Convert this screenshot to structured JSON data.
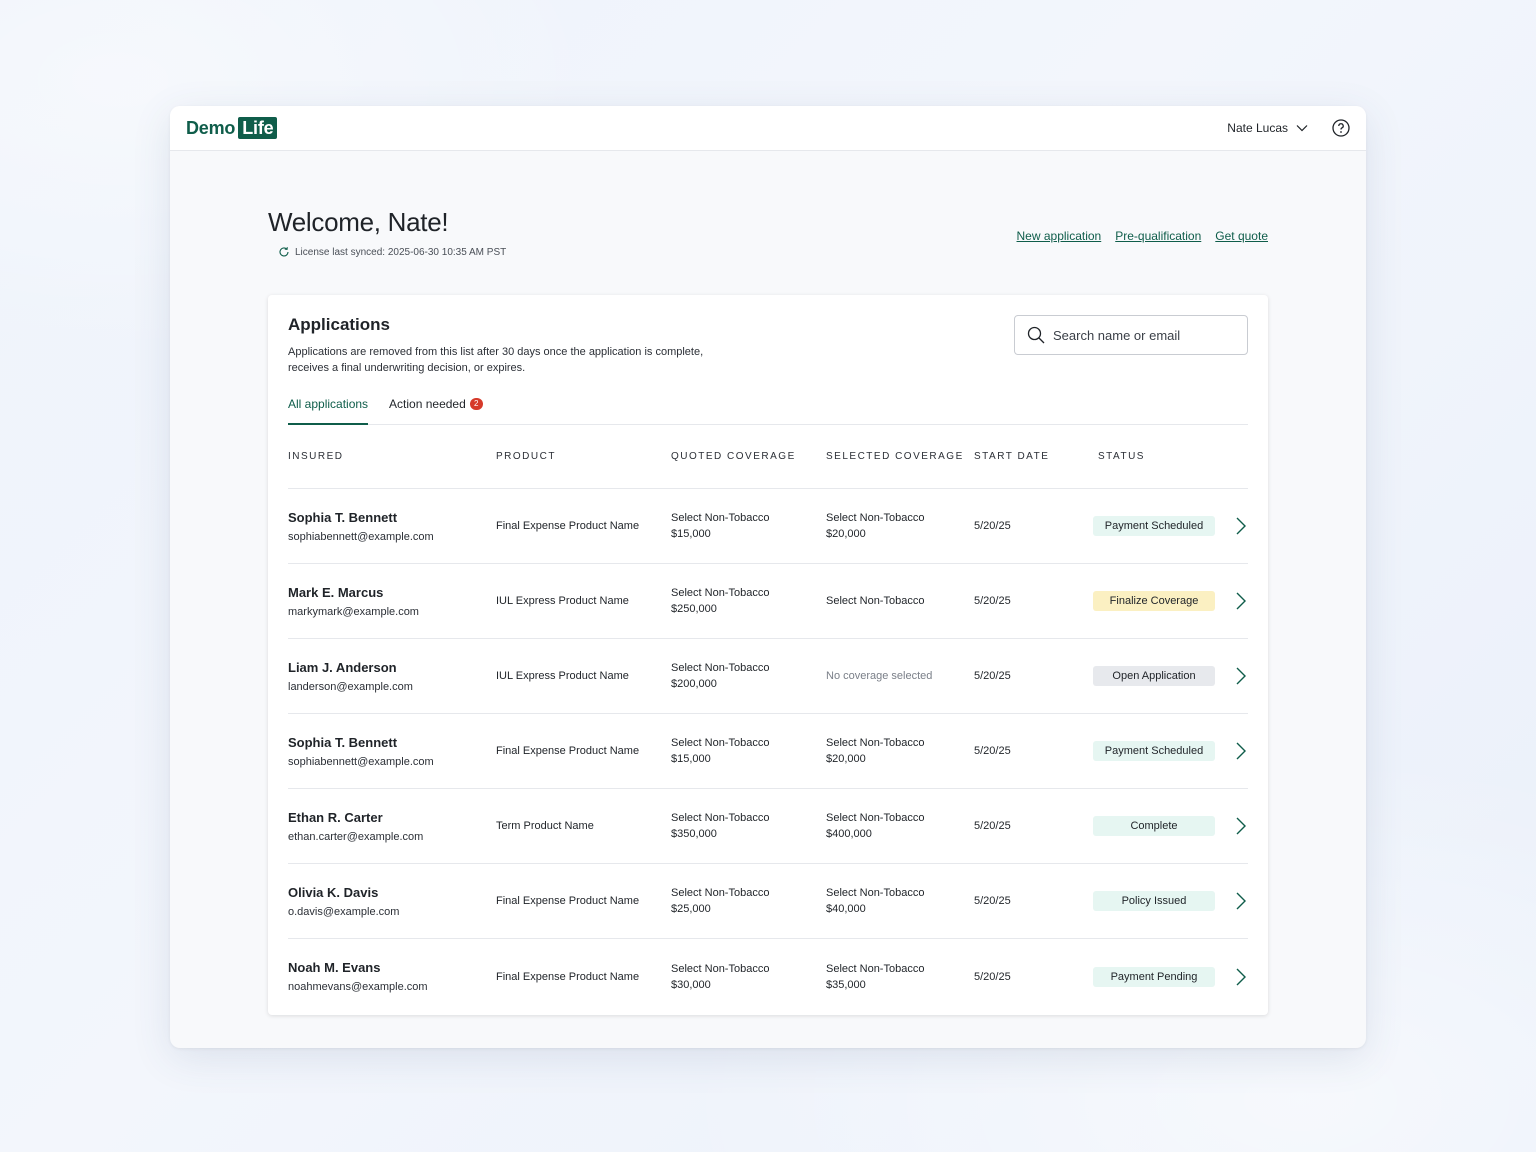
{
  "header": {
    "logo_demo": "Demo",
    "logo_life": "Life",
    "user_name": "Nate Lucas"
  },
  "welcome": {
    "title": "Welcome, Nate!",
    "sync_text": "License last synced: 2025-06-30 10:35 AM PST",
    "links": [
      "New application",
      "Pre-qualification",
      "Get quote"
    ]
  },
  "applications": {
    "title": "Applications",
    "description": "Applications are removed from this list after 30 days once the application is complete, receives a final underwriting decision, or expires.",
    "search_placeholder": "Search name or email",
    "tabs": [
      {
        "label": "All applications",
        "active": true
      },
      {
        "label": "Action needed",
        "count": "2"
      }
    ],
    "columns": [
      "Insured",
      "Product",
      "Quoted coverage",
      "Selected coverage",
      "Start date",
      "Status"
    ],
    "rows": [
      {
        "name": "Sophia T. Bennett",
        "email": "sophiabennett@example.com",
        "product": "Final Expense Product Name",
        "quoted_plan": "Select Non-Tobacco",
        "quoted_amount": "$15,000",
        "selected_plan": "Select Non-Tobacco",
        "selected_amount": "$20,000",
        "start_date": "5/20/25",
        "status": "Payment Scheduled",
        "status_color": "#e6f6f2"
      },
      {
        "name": "Mark E. Marcus",
        "email": "markymark@example.com",
        "product": "IUL Express Product Name",
        "quoted_plan": "Select Non-Tobacco",
        "quoted_amount": "$250,000",
        "selected_plan": "Select Non-Tobacco",
        "selected_amount": "",
        "start_date": "5/20/25",
        "status": "Finalize Coverage",
        "status_color": "#fbf0c2"
      },
      {
        "name": "Liam J. Anderson",
        "email": "landerson@example.com",
        "product": "IUL Express Product Name",
        "quoted_plan": "Select Non-Tobacco",
        "quoted_amount": "$200,000",
        "selected_plan": "No coverage selected",
        "selected_amount": "",
        "start_date": "5/20/25",
        "status": "Open Application",
        "status_color": "#e7e9ed"
      },
      {
        "name": "Sophia T. Bennett",
        "email": "sophiabennett@example.com",
        "product": "Final Expense Product Name",
        "quoted_plan": "Select Non-Tobacco",
        "quoted_amount": "$15,000",
        "selected_plan": "Select Non-Tobacco",
        "selected_amount": "$20,000",
        "start_date": "5/20/25",
        "status": "Payment Scheduled",
        "status_color": "#e6f6f2"
      },
      {
        "name": "Ethan R. Carter",
        "email": "ethan.carter@example.com",
        "product": "Term Product Name",
        "quoted_plan": "Select Non-Tobacco",
        "quoted_amount": "$350,000",
        "selected_plan": "Select Non-Tobacco",
        "selected_amount": "$400,000",
        "start_date": "5/20/25",
        "status": "Complete",
        "status_color": "#e6f6f2"
      },
      {
        "name": "Olivia K. Davis",
        "email": "o.davis@example.com",
        "product": "Final Expense Product Name",
        "quoted_plan": "Select Non-Tobacco",
        "quoted_amount": "$25,000",
        "selected_plan": "Select Non-Tobacco",
        "selected_amount": "$40,000",
        "start_date": "5/20/25",
        "status": "Policy Issued",
        "status_color": "#e6f6f2"
      },
      {
        "name": "Noah M. Evans",
        "email": "noahmevans@example.com",
        "product": "Final Expense Product Name",
        "quoted_plan": "Select Non-Tobacco",
        "quoted_amount": "$30,000",
        "selected_plan": "Select Non-Tobacco",
        "selected_amount": "$35,000",
        "start_date": "5/20/25",
        "status": "Payment Pending",
        "status_color": "#e6f6f2"
      }
    ]
  },
  "colors": {
    "brand": "#0f5d4a",
    "badge": "#d63a2a",
    "status_green": "#e6f6f2",
    "status_yellow": "#fbf0c2",
    "status_grey": "#e7e9ed"
  },
  "icons": [
    "chevron-down-icon",
    "help-circle-icon",
    "sync-icon",
    "search-icon",
    "chevron-right-icon"
  ]
}
